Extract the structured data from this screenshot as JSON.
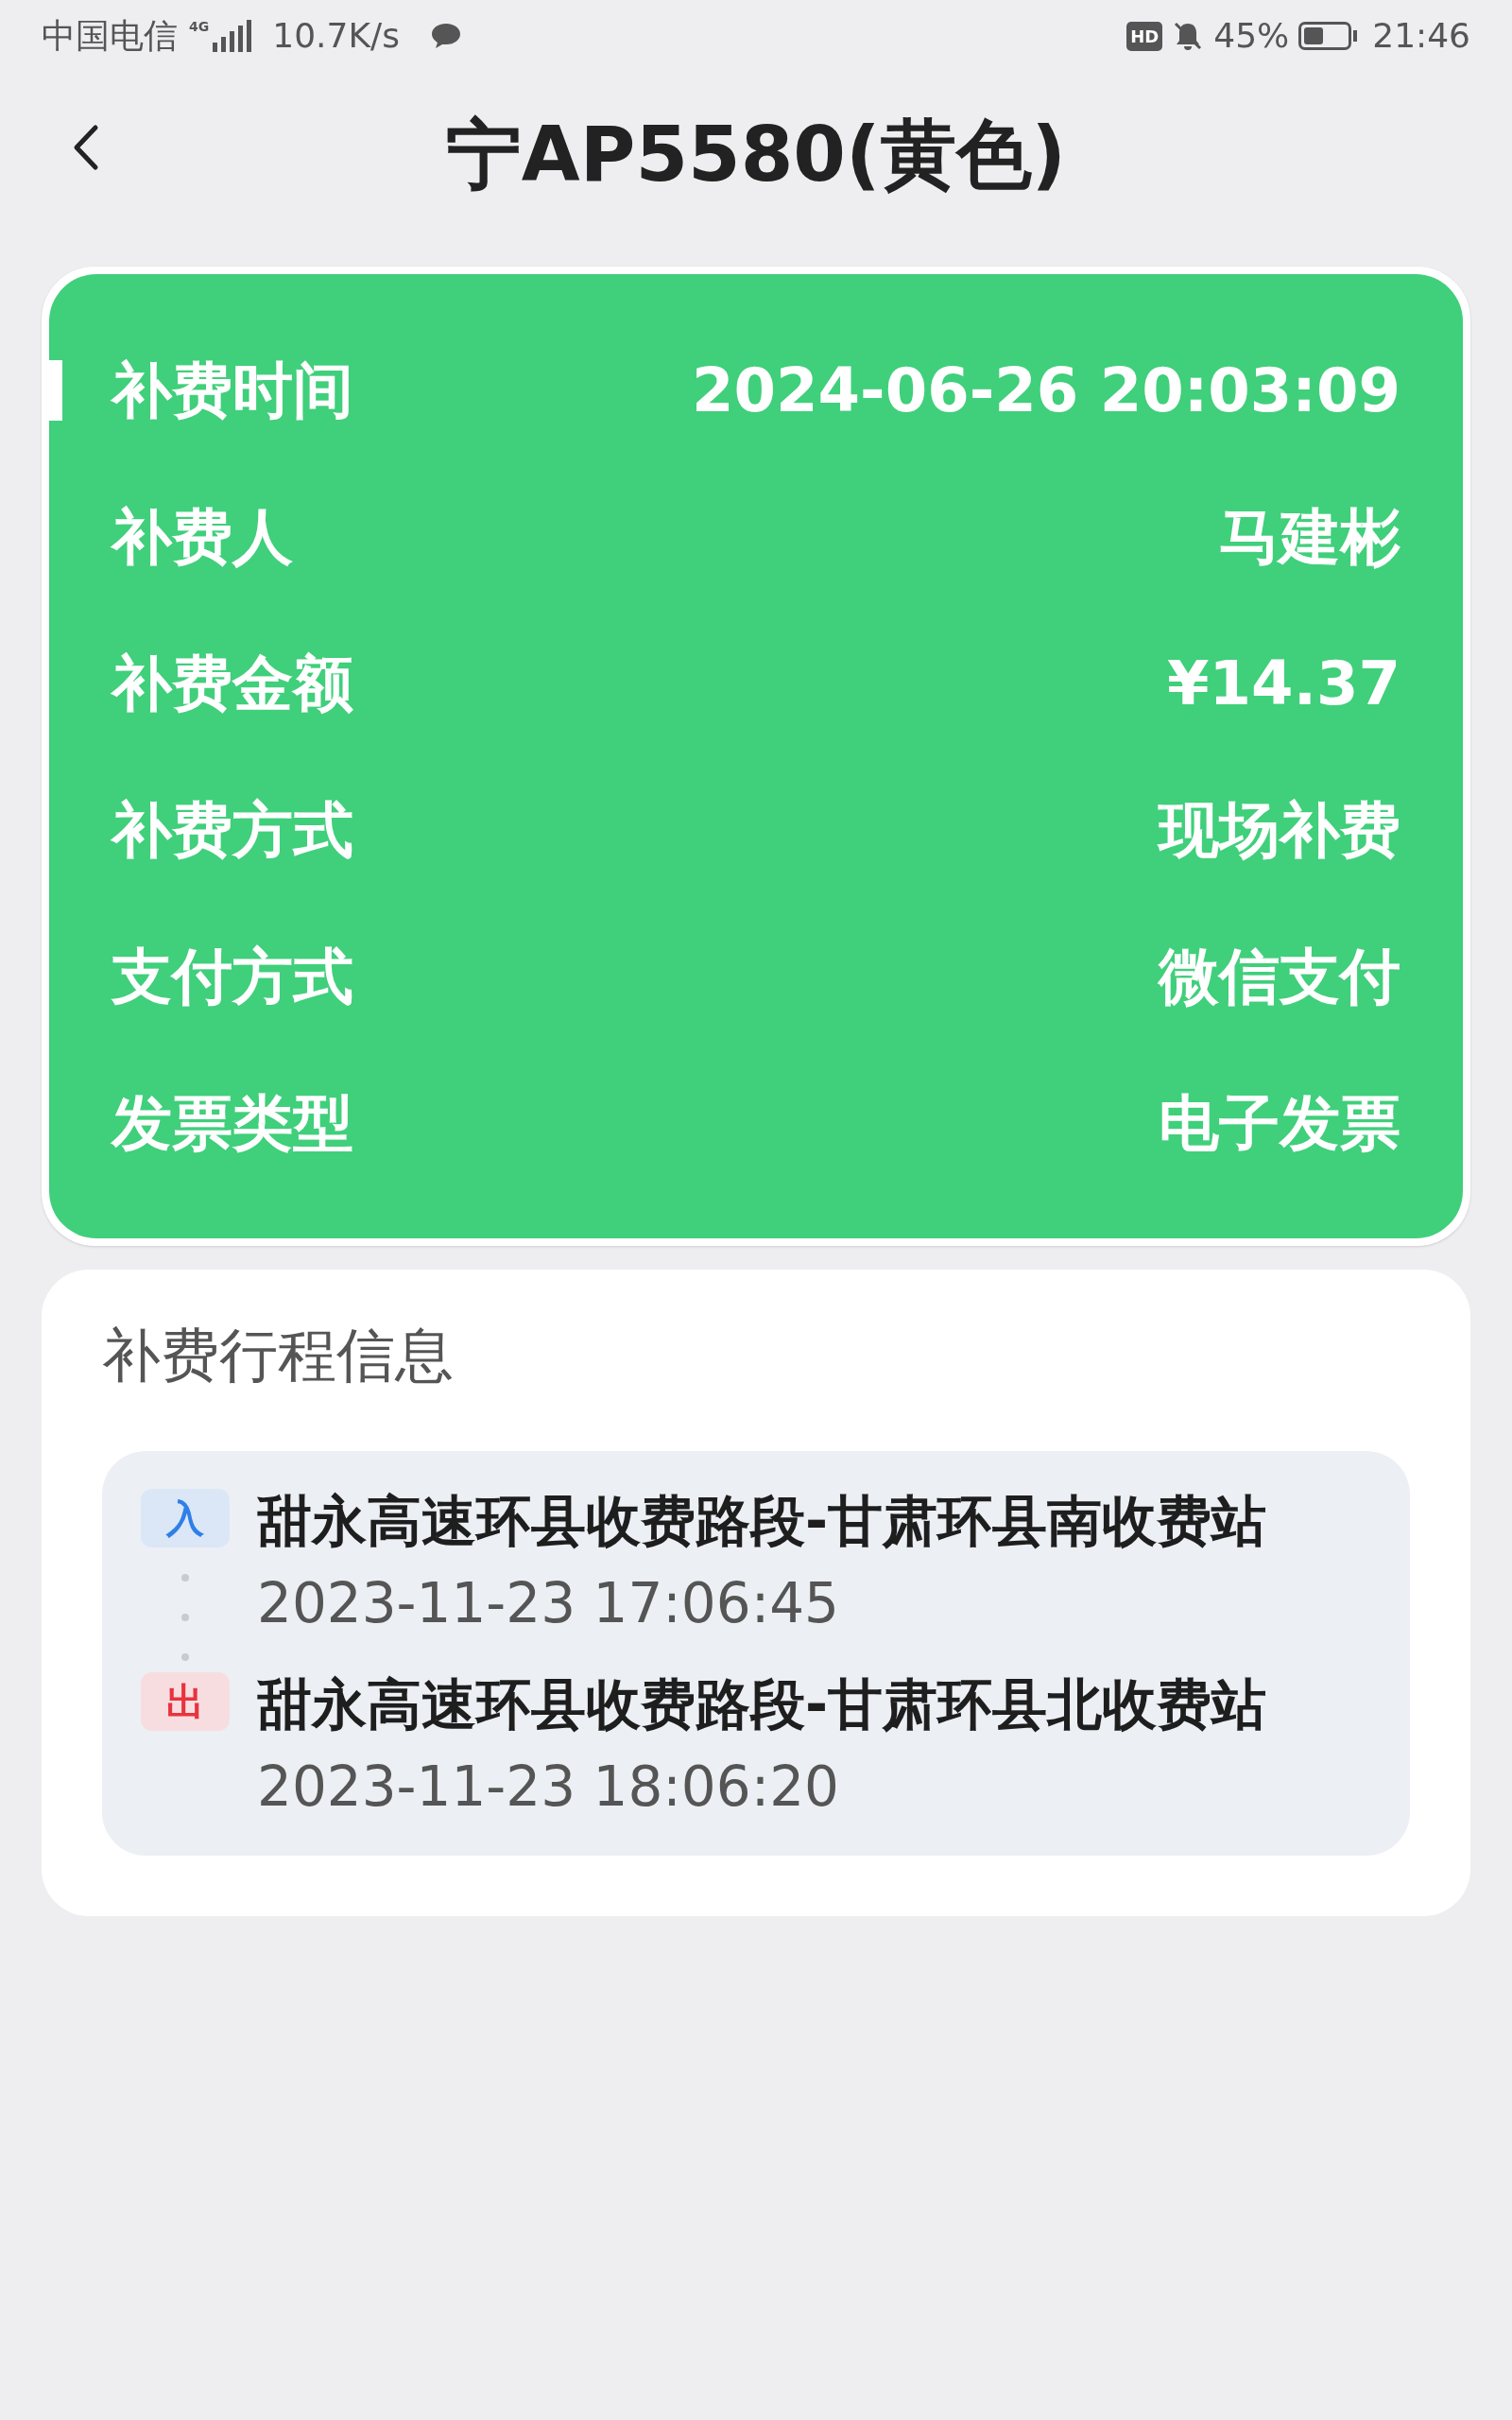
{
  "status_bar": {
    "carrier": "中国电信",
    "network": "4G",
    "speed": "10.7K/s",
    "hd": "HD",
    "battery": "45%",
    "time": "21:46"
  },
  "header": {
    "title": "宁AP5580(黄色)"
  },
  "details": [
    {
      "label": "补费时间",
      "value": "2024-06-26 20:03:09",
      "highlighted": true
    },
    {
      "label": "补费人",
      "value": "马建彬",
      "highlighted": false
    },
    {
      "label": "补费金额",
      "value": "¥14.37",
      "highlighted": false
    },
    {
      "label": "补费方式",
      "value": "现场补费",
      "highlighted": false
    },
    {
      "label": "支付方式",
      "value": "微信支付",
      "highlighted": false
    },
    {
      "label": "发票类型",
      "value": "电子发票",
      "highlighted": false
    }
  ],
  "trip": {
    "title": "补费行程信息",
    "stops": [
      {
        "kind": "entry",
        "badge": "入",
        "station": "甜永高速环县收费路段-甘肃环县南收费站",
        "time": "2023-11-23 17:06:45"
      },
      {
        "kind": "exit",
        "badge": "出",
        "station": "甜永高速环县收费路段-甘肃环县北收费站",
        "time": "2023-11-23 18:06:20"
      }
    ]
  }
}
